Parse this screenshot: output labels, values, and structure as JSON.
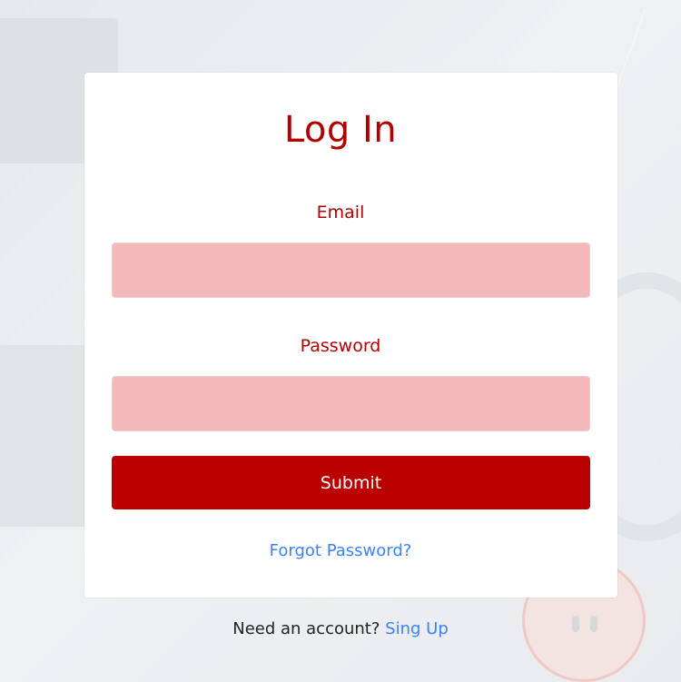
{
  "login": {
    "title": "Log In",
    "email_label": "Email",
    "email_value": "",
    "password_label": "Password",
    "password_value": "",
    "submit_label": "Submit",
    "forgot_link": "Forgot Password?"
  },
  "footer": {
    "prompt": "Need an account?",
    "signup_link": "Sing Up"
  },
  "colors": {
    "accent": "#bb0000",
    "heading": "#b30000",
    "input_bg": "#f5b8b8",
    "link": "#3b82f6"
  }
}
